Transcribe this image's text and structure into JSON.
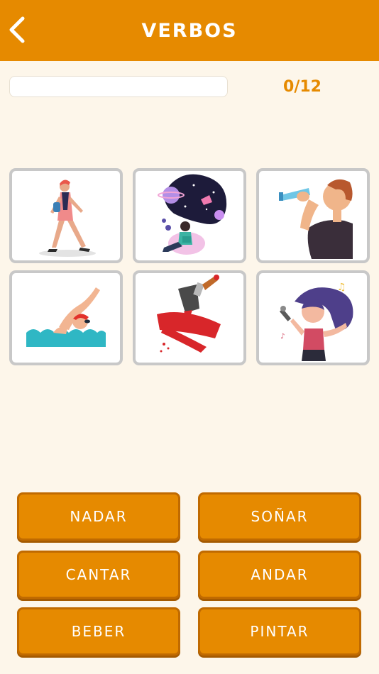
{
  "header": {
    "title": "VERBOS",
    "back_icon": "chevron-left-icon"
  },
  "progress": {
    "score_text": "0/12",
    "fraction": 0
  },
  "picture_cards": [
    {
      "icon": "walking-person-icon"
    },
    {
      "icon": "dreaming-person-icon"
    },
    {
      "icon": "drinking-person-icon"
    },
    {
      "icon": "swimming-person-icon"
    },
    {
      "icon": "paint-brush-icon"
    },
    {
      "icon": "singing-person-icon"
    }
  ],
  "answers": [
    {
      "label": "NADAR"
    },
    {
      "label": "SOÑAR"
    },
    {
      "label": "CANTAR"
    },
    {
      "label": "ANDAR"
    },
    {
      "label": "BEBER"
    },
    {
      "label": "PINTAR"
    }
  ],
  "colors": {
    "accent": "#e68a00",
    "background": "#fdf6ea",
    "card_border": "#c8c8c8"
  }
}
